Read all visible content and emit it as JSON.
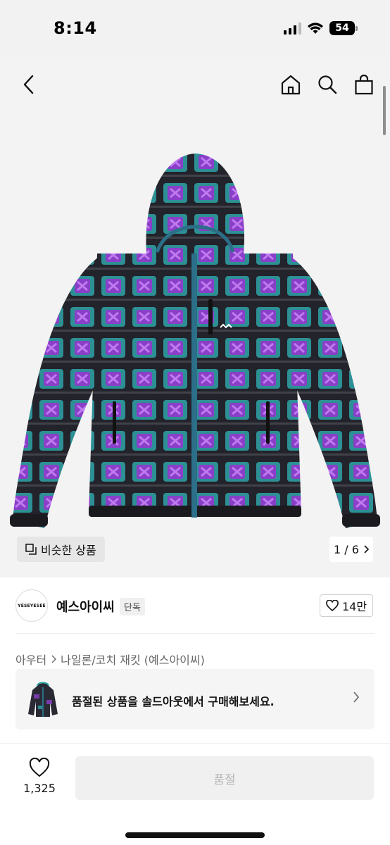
{
  "status_bar": {
    "time": "8:14",
    "battery": "54"
  },
  "gallery": {
    "similar_label": "비슷한 상품",
    "pager": "1 / 6"
  },
  "brand": {
    "logo_text": "YESEYESEE",
    "name": "예스아이씨",
    "exclusive_badge": "단독",
    "likes": "14만"
  },
  "breadcrumb": {
    "category": "아우터",
    "subcategory": "나일론/코치 재킷 (예스아이씨)"
  },
  "soldout_banner": {
    "text": "품절된 상품을 솔드아웃에서 구매해보세요."
  },
  "bottom_bar": {
    "wish_count": "1,325",
    "buy_label": "품절"
  },
  "colors": {
    "jacket_base": "#2a2a33",
    "jacket_teal": "#2fa3a8",
    "jacket_purple": "#8a3fc8",
    "zipper": "#2b6f88"
  }
}
